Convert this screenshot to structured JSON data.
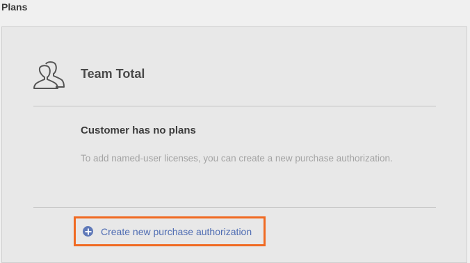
{
  "section": {
    "title": "Plans"
  },
  "plan_card": {
    "icon": "team-users-icon",
    "title": "Team Total",
    "empty_state": {
      "heading": "Customer has no plans",
      "description": "To add named-user licenses, you can create a new purchase authorization."
    },
    "action": {
      "icon": "plus-circle-icon",
      "label": "Create new purchase authorization"
    }
  },
  "colors": {
    "link": "#4f6db3",
    "highlight_border": "#f06a22",
    "card_background": "#e8e8e8"
  }
}
